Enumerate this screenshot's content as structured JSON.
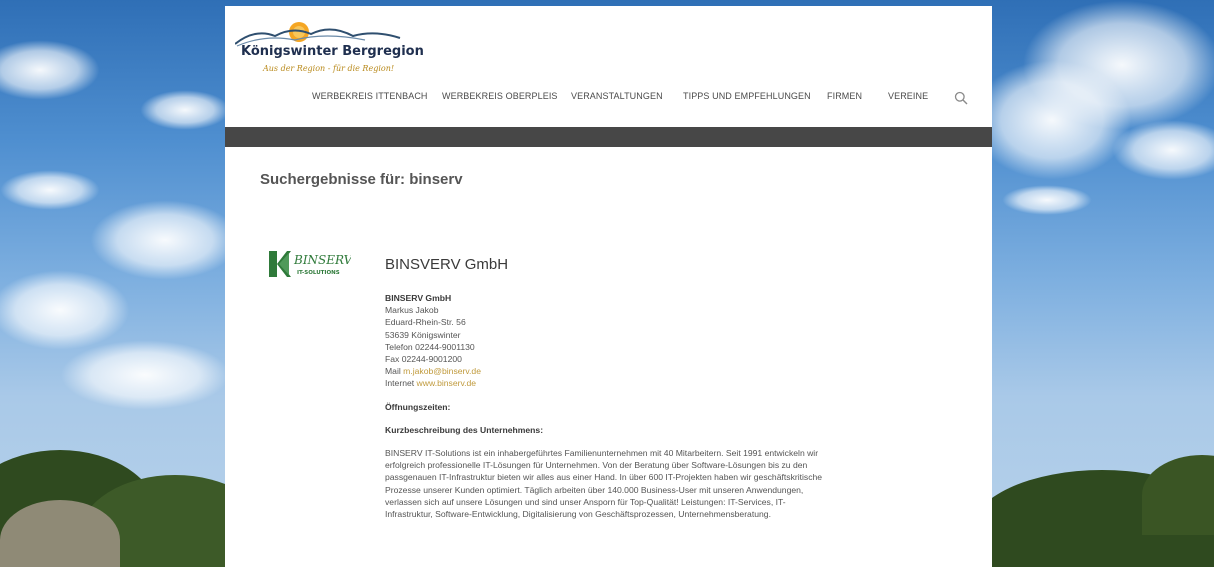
{
  "site": {
    "logo_title": "Königswinter Bergregion",
    "logo_tagline": "Aus der Region - für die Region!"
  },
  "nav": {
    "items": [
      "WERBEKREIS ITTENBACH",
      "WERBEKREIS OBERPLEIS",
      "VERANSTALTUNGEN",
      "TIPPS UND EMPFEHLUNGEN",
      "FIRMEN",
      "VEREINE"
    ],
    "search_icon": "search-icon"
  },
  "search": {
    "heading": "Suchergebnisse für: binserv"
  },
  "result": {
    "logo_text": "BINSERV",
    "logo_subtext": "IT-SOLUTIONS",
    "title": "BINSVERV GmbH",
    "company": "BINSERV GmbH",
    "contact": "Markus Jakob",
    "street": "Eduard-Rhein-Str. 56",
    "city": "53639 Königswinter",
    "phone": "Telefon 02244-9001130",
    "fax": "Fax 02244-9001200",
    "mail_label": "Mail",
    "mail": "m.jakob@binserv.de",
    "internet_label": "Internet",
    "internet": "www.binserv.de",
    "opening_label": "Öffnungszeiten:",
    "description_label": "Kurzbeschreibung des Unternehmens:",
    "description": "BINSERV IT-Solutions ist ein inhabergeführtes Familienunternehmen mit 40 Mitarbeitern. Seit 1991 entwickeln wir erfolgreich professionelle IT-Lösungen für Unternehmen. Von der Beratung über Software-Lösungen bis zu den passgenauen IT-Infrastruktur bieten wir alles aus einer Hand. In über 600 IT-Projekten haben wir geschäftskritische Prozesse unserer Kunden optimiert. Täglich arbeiten über 140.000 Business-User mit unseren Anwendungen, verlassen sich auf unsere Lösungen und sind unser Ansporn für Top-Qualität! Leistungen: IT-Services, IT-Infrastruktur, Software-Entwicklung, Digitalisierung von Geschäftsprozessen, Unternehmensberatung."
  },
  "colors": {
    "link": "#c09a3c",
    "bar": "#474747",
    "logo_green": "#2f7a3a"
  }
}
